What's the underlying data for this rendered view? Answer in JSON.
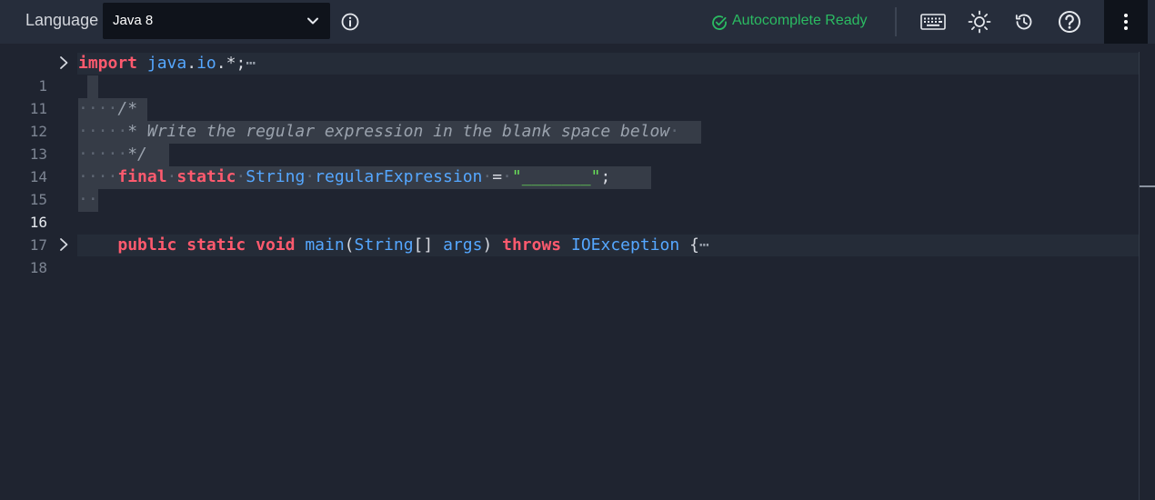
{
  "toolbar": {
    "language_label": "Language",
    "language_value": "Java 8",
    "autocomplete_status": "Autocomplete Ready",
    "status_color": "#2bbb62",
    "icons": [
      "info-icon",
      "keyboard-icon",
      "sun-icon",
      "history-icon",
      "help-icon",
      "more-vertical-icon"
    ]
  },
  "editor": {
    "line_numbers": [
      "1",
      "11",
      "12",
      "13",
      "14",
      "15",
      "16",
      "17",
      "18"
    ],
    "active_line": "16",
    "colors": {
      "keyword": "#ff5a6e",
      "type": "#55a7ff",
      "string": "#6be25a",
      "comment": "#9aa2ad"
    },
    "lines": {
      "l1": {
        "t1": "import",
        "t2": "java",
        "t3": ".",
        "t4": "io",
        "t5": ".*;",
        "ell": "⋯"
      },
      "l12": {
        "ws": "····",
        "t1": "/*"
      },
      "l13": {
        "ws": "·····",
        "t1": "* Write the regular expression in the blank space below",
        "tw": "·"
      },
      "l14": {
        "ws": "·····",
        "t1": "*/"
      },
      "l15": {
        "ws": "····",
        "t1": "final",
        "t2": "static",
        "t3": "String",
        "t4": "regularExpression",
        "t5": "=",
        "t6": "\"_______\"",
        "t7": ";"
      },
      "l16": {
        "ws": "··"
      },
      "l18": {
        "ws": "    ",
        "t1": "public",
        "t2": "static",
        "t3": "void",
        "t4": "main",
        "t5": "(",
        "t6": "String",
        "t7": "[]",
        "t8": "args",
        "t9": ")",
        "t10": "throws",
        "t11": "IOException",
        "t12": "{",
        "ell": "⋯"
      }
    }
  }
}
